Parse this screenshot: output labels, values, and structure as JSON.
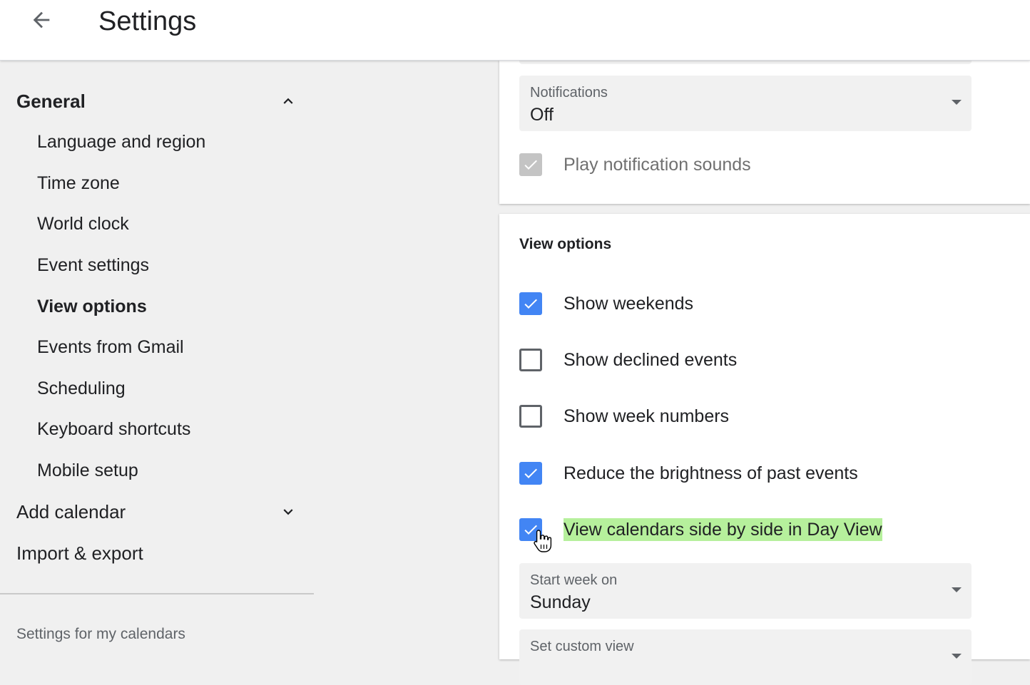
{
  "header": {
    "title": "Settings",
    "back_icon": "arrow-back-icon"
  },
  "sidebar": {
    "general": {
      "label": "General",
      "expanded": true,
      "icon": "chevron-up-icon"
    },
    "general_items": [
      {
        "label": "Language and region"
      },
      {
        "label": "Time zone"
      },
      {
        "label": "World clock"
      },
      {
        "label": "Event settings"
      },
      {
        "label": "View options",
        "active": true
      },
      {
        "label": "Events from Gmail"
      },
      {
        "label": "Scheduling"
      },
      {
        "label": "Keyboard shortcuts"
      },
      {
        "label": "Mobile setup"
      }
    ],
    "add_calendar": {
      "label": "Add calendar",
      "expanded": false,
      "icon": "chevron-down-icon"
    },
    "import_export": {
      "label": "Import & export"
    },
    "footer_label": "Settings for my calendars"
  },
  "notifications_card": {
    "notifications": {
      "label": "Notifications",
      "value": "Off"
    },
    "play_sounds": {
      "label": "Play notification sounds",
      "checked": true,
      "disabled": true
    }
  },
  "view_options_card": {
    "title": "View options",
    "options": [
      {
        "label": "Show weekends",
        "checked": true
      },
      {
        "label": "Show declined events",
        "checked": false
      },
      {
        "label": "Show week numbers",
        "checked": false
      },
      {
        "label": "Reduce the brightness of past events",
        "checked": true
      },
      {
        "label": "View calendars side by side in Day View",
        "checked": true,
        "highlighted": true
      }
    ],
    "start_week": {
      "label": "Start week on",
      "value": "Sunday"
    },
    "custom_view": {
      "label": "Set custom view",
      "value": ""
    }
  },
  "colors": {
    "accent": "#4285f4",
    "highlight": "#b6f09c",
    "sidebar_bg": "#f0f0f0",
    "text": "#202124",
    "muted": "#5f6368"
  }
}
